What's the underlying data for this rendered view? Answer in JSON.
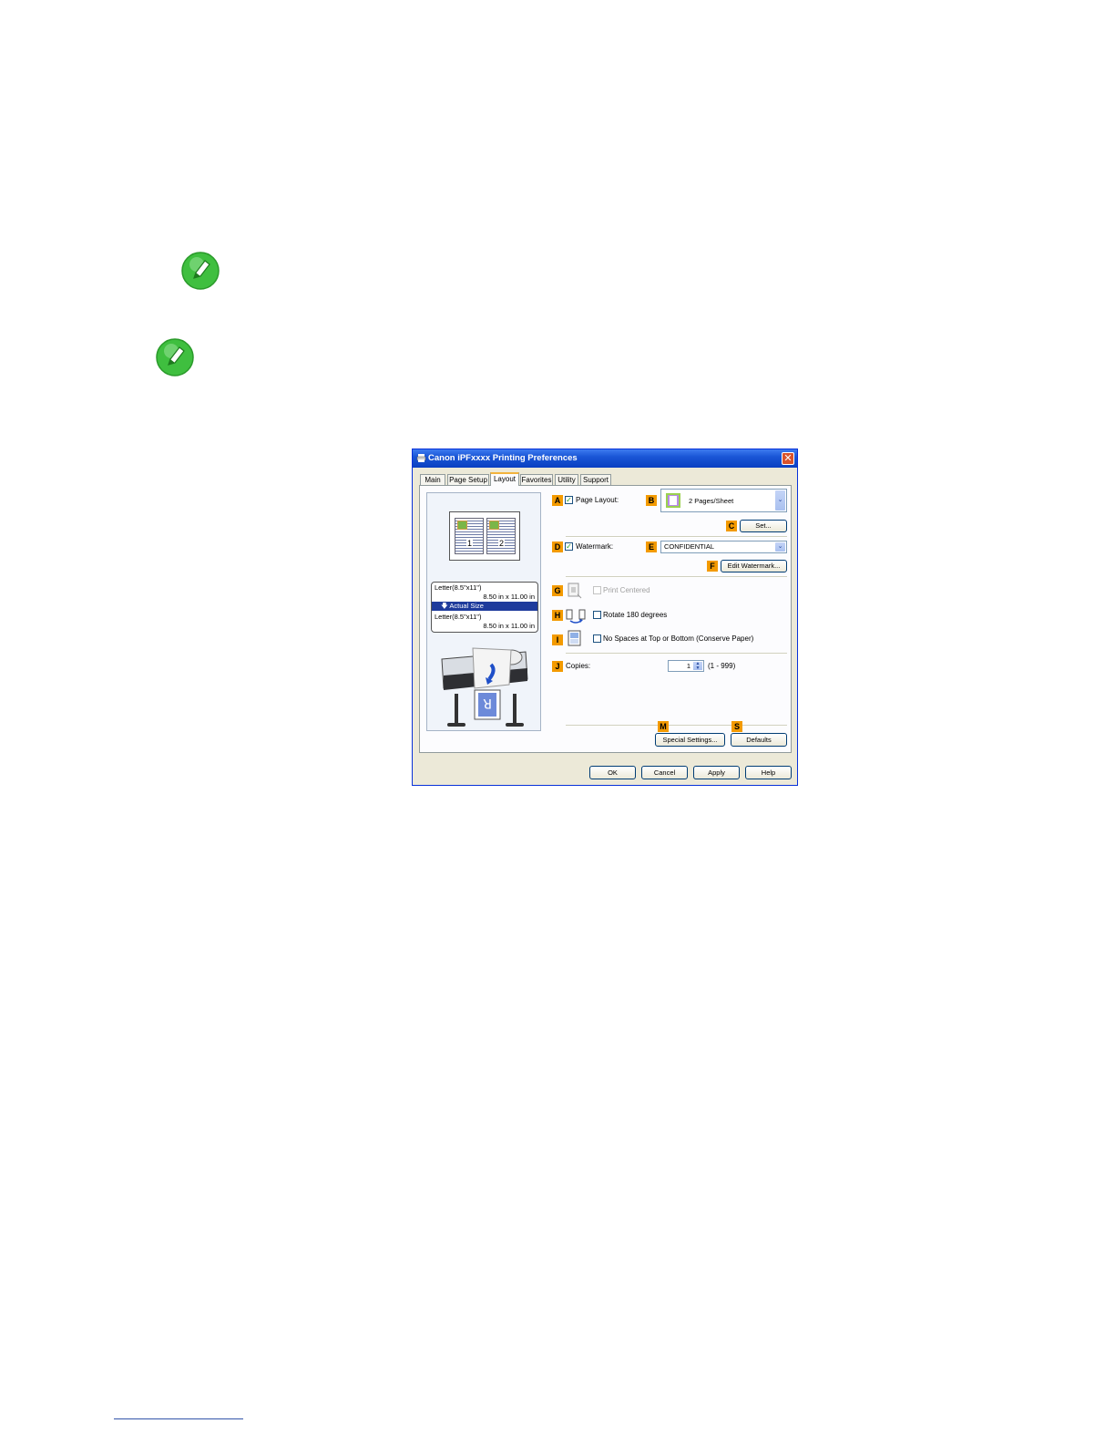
{
  "notes": {
    "icon_color": "#3fbf3f"
  },
  "dialog": {
    "title": "Canon iPFxxxx Printing Preferences",
    "tabs": [
      {
        "label": "Main"
      },
      {
        "label": "Page Setup"
      },
      {
        "label": "Layout"
      },
      {
        "label": "Favorites"
      },
      {
        "label": "Utility"
      },
      {
        "label": "Support"
      }
    ],
    "preview": {
      "page1": "1",
      "page2": "2",
      "source_size": "Letter(8.5\"x11\")",
      "source_dims": "8.50 in x 11.00 in",
      "mode": "Actual Size",
      "output_size": "Letter(8.5\"x11\")",
      "output_dims": "8.50 in x 11.00 in"
    },
    "page_layout": {
      "letter": "A",
      "label": "Page Layout:",
      "checked": true
    },
    "pages_per_sheet": {
      "letter": "B",
      "value": "2 Pages/Sheet"
    },
    "set_button": {
      "letter": "C",
      "label": "Set..."
    },
    "watermark": {
      "letter": "D",
      "label": "Watermark:",
      "checked": true
    },
    "watermark_select": {
      "letter": "E",
      "value": "CONFIDENTIAL"
    },
    "edit_watermark": {
      "letter": "F",
      "label": "Edit Watermark..."
    },
    "print_centered": {
      "letter": "G",
      "label": "Print Centered",
      "enabled": false
    },
    "rotate": {
      "letter": "H",
      "label": "Rotate 180 degrees"
    },
    "no_spaces": {
      "letter": "I",
      "label": "No Spaces at Top or Bottom (Conserve Paper)"
    },
    "copies": {
      "letter": "J",
      "label": "Copies:",
      "value": "1",
      "range": "(1 - 999)"
    },
    "special_settings": {
      "letter": "M",
      "label": "Special Settings..."
    },
    "defaults": {
      "letter": "S",
      "label": "Defaults"
    },
    "footer": {
      "ok": "OK",
      "cancel": "Cancel",
      "apply": "Apply",
      "help": "Help"
    },
    "accent_color": "#f39a00"
  }
}
